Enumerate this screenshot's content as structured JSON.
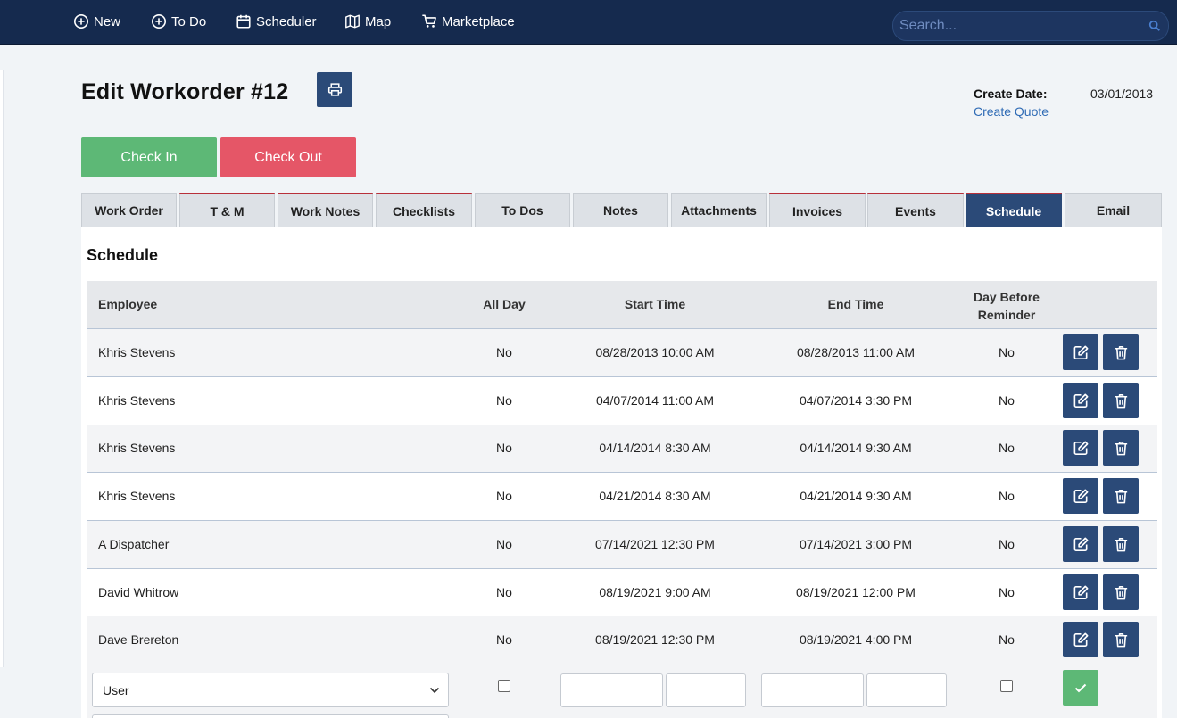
{
  "nav": {
    "items": [
      {
        "label": "New",
        "icon": "plus-circle-icon"
      },
      {
        "label": "To Do",
        "icon": "plus-circle-icon"
      },
      {
        "label": "Scheduler",
        "icon": "calendar-icon"
      },
      {
        "label": "Map",
        "icon": "map-icon"
      },
      {
        "label": "Marketplace",
        "icon": "cart-icon"
      }
    ],
    "search_placeholder": "Search..."
  },
  "header": {
    "title": "Edit Workorder #12",
    "create_date_label": "Create Date:",
    "create_date_value": "03/01/2013",
    "create_quote_label": "Create Quote"
  },
  "actions": {
    "check_in": "Check In",
    "check_out": "Check Out"
  },
  "tabs": [
    {
      "label": "Work Order"
    },
    {
      "label": "T & M"
    },
    {
      "label": "Work Notes"
    },
    {
      "label": "Checklists"
    },
    {
      "label": "To Dos"
    },
    {
      "label": "Notes"
    },
    {
      "label": "Attachments"
    },
    {
      "label": "Invoices"
    },
    {
      "label": "Events"
    },
    {
      "label": "Schedule"
    },
    {
      "label": "Email"
    }
  ],
  "active_tab": "Schedule",
  "schedule": {
    "title": "Schedule",
    "columns": {
      "employee": "Employee",
      "all_day": "All Day",
      "start_time": "Start Time",
      "end_time": "End Time",
      "reminder_line1": "Day Before",
      "reminder_line2": "Reminder"
    },
    "rows": [
      {
        "employee": "Khris Stevens",
        "all_day": "No",
        "start": "08/28/2013 10:00 AM",
        "end": "08/28/2013 11:00 AM",
        "reminder": "No"
      },
      {
        "employee": "Khris Stevens",
        "all_day": "No",
        "start": "04/07/2014 11:00 AM",
        "end": "04/07/2014 3:30 PM",
        "reminder": "No"
      },
      {
        "employee": "Khris Stevens",
        "all_day": "No",
        "start": "04/14/2014 8:30 AM",
        "end": "04/14/2014 9:30 AM",
        "reminder": "No"
      },
      {
        "employee": "Khris Stevens",
        "all_day": "No",
        "start": "04/21/2014 8:30 AM",
        "end": "04/21/2014 9:30 AM",
        "reminder": "No"
      },
      {
        "employee": "A Dispatcher",
        "all_day": "No",
        "start": "07/14/2021 12:30 PM",
        "end": "07/14/2021 3:00 PM",
        "reminder": "No"
      },
      {
        "employee": "David Whitrow",
        "all_day": "No",
        "start": "08/19/2021 9:00 AM",
        "end": "08/19/2021 12:00 PM",
        "reminder": "No"
      },
      {
        "employee": "Dave Brereton",
        "all_day": "No",
        "start": "08/19/2021 12:30 PM",
        "end": "08/19/2021 4:00 PM",
        "reminder": "No"
      }
    ],
    "new_row": {
      "user_select_value": "User"
    }
  },
  "colors": {
    "topbar": "#152a4e",
    "primary": "#2b4a78",
    "success": "#5db876",
    "danger": "#e55667",
    "link": "#2f6bb5",
    "tab_accent": "#b8303a"
  }
}
